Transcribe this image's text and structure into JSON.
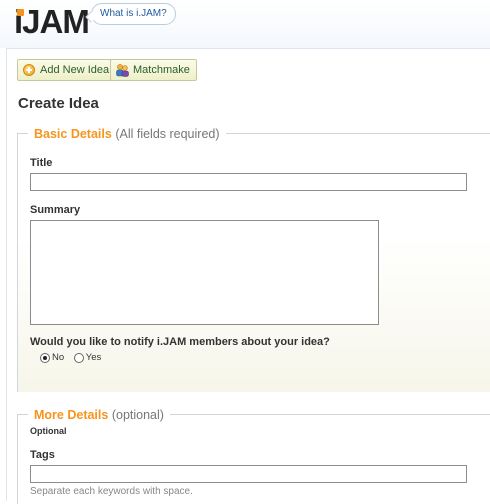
{
  "header": {
    "logo_text": "JAM",
    "logo_prefix": "i",
    "whatis_label": "What is i.JAM?"
  },
  "toolbar": {
    "add_idea_label": "Add New Idea",
    "matchmake_label": "Matchmake"
  },
  "page": {
    "title": "Create Idea"
  },
  "basic_details": {
    "legend": "Basic Details",
    "legend_note": "(All fields required)",
    "title_label": "Title",
    "title_value": "",
    "summary_label": "Summary",
    "summary_value": "",
    "notify_question": "Would you like to notify i.JAM members about your idea?",
    "options": [
      "No",
      "Yes"
    ],
    "selected": "No"
  },
  "more_details": {
    "legend": "More Details",
    "legend_note": "(optional)",
    "optional_label": "Optional",
    "tags_label": "Tags",
    "tags_value": "",
    "tags_hint": "Separate each keywords with space."
  },
  "colors": {
    "accent": "#f7941d",
    "button_bg": "#eef0c8",
    "link": "#1f5b99"
  }
}
